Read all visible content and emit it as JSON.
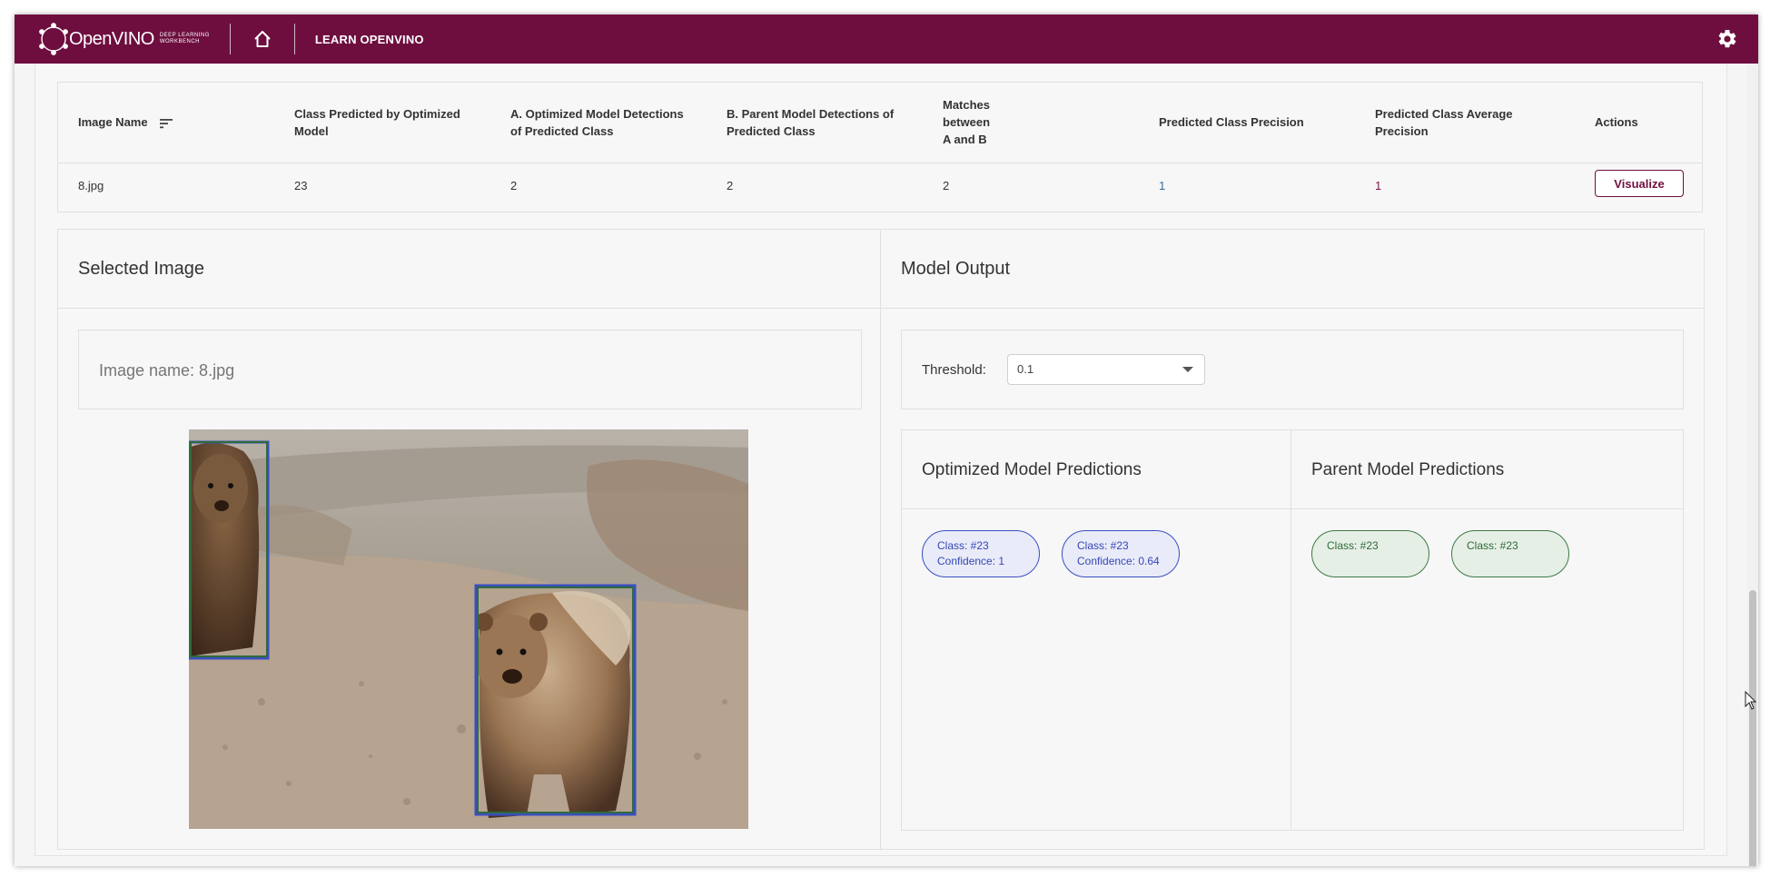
{
  "header": {
    "logo_name": "OpenVINO",
    "logo_sub_1": "DEEP LEARNING",
    "logo_sub_2": "WORKBENCH",
    "learn_link": "LEARN OPENVINO",
    "brand_color": "#6e0e3f"
  },
  "table": {
    "headers": [
      "Image Name",
      "Class Predicted by Optimized Model",
      "A. Optimized Model Detections of Predicted Class",
      "B. Parent Model Detections of Predicted Class",
      "Matches between A and B",
      "Predicted Class Precision",
      "Predicted Class Average Precision",
      "Actions"
    ],
    "row": {
      "image_name": "8.jpg",
      "class_predicted": "23",
      "optimized_detections": "2",
      "parent_detections": "2",
      "matches": "2",
      "precision": "1",
      "average_precision": "1",
      "action_label": "Visualize"
    }
  },
  "selected_image": {
    "title": "Selected Image",
    "image_name_label": "Image name: 8.jpg"
  },
  "model_output": {
    "title": "Model Output",
    "threshold_label": "Threshold:",
    "threshold_value": "0.1",
    "optimized_title": "Optimized Model Predictions",
    "parent_title": "Parent Model Predictions",
    "optimized_predictions": [
      {
        "class": "Class: #23",
        "confidence": "Confidence: 1"
      },
      {
        "class": "Class: #23",
        "confidence": "Confidence: 0.64"
      }
    ],
    "parent_predictions": [
      {
        "class": "Class: #23"
      },
      {
        "class": "Class: #23"
      }
    ]
  },
  "colors": {
    "optimized_box": "#3a4fc0",
    "parent_box": "#2e6b3a"
  }
}
